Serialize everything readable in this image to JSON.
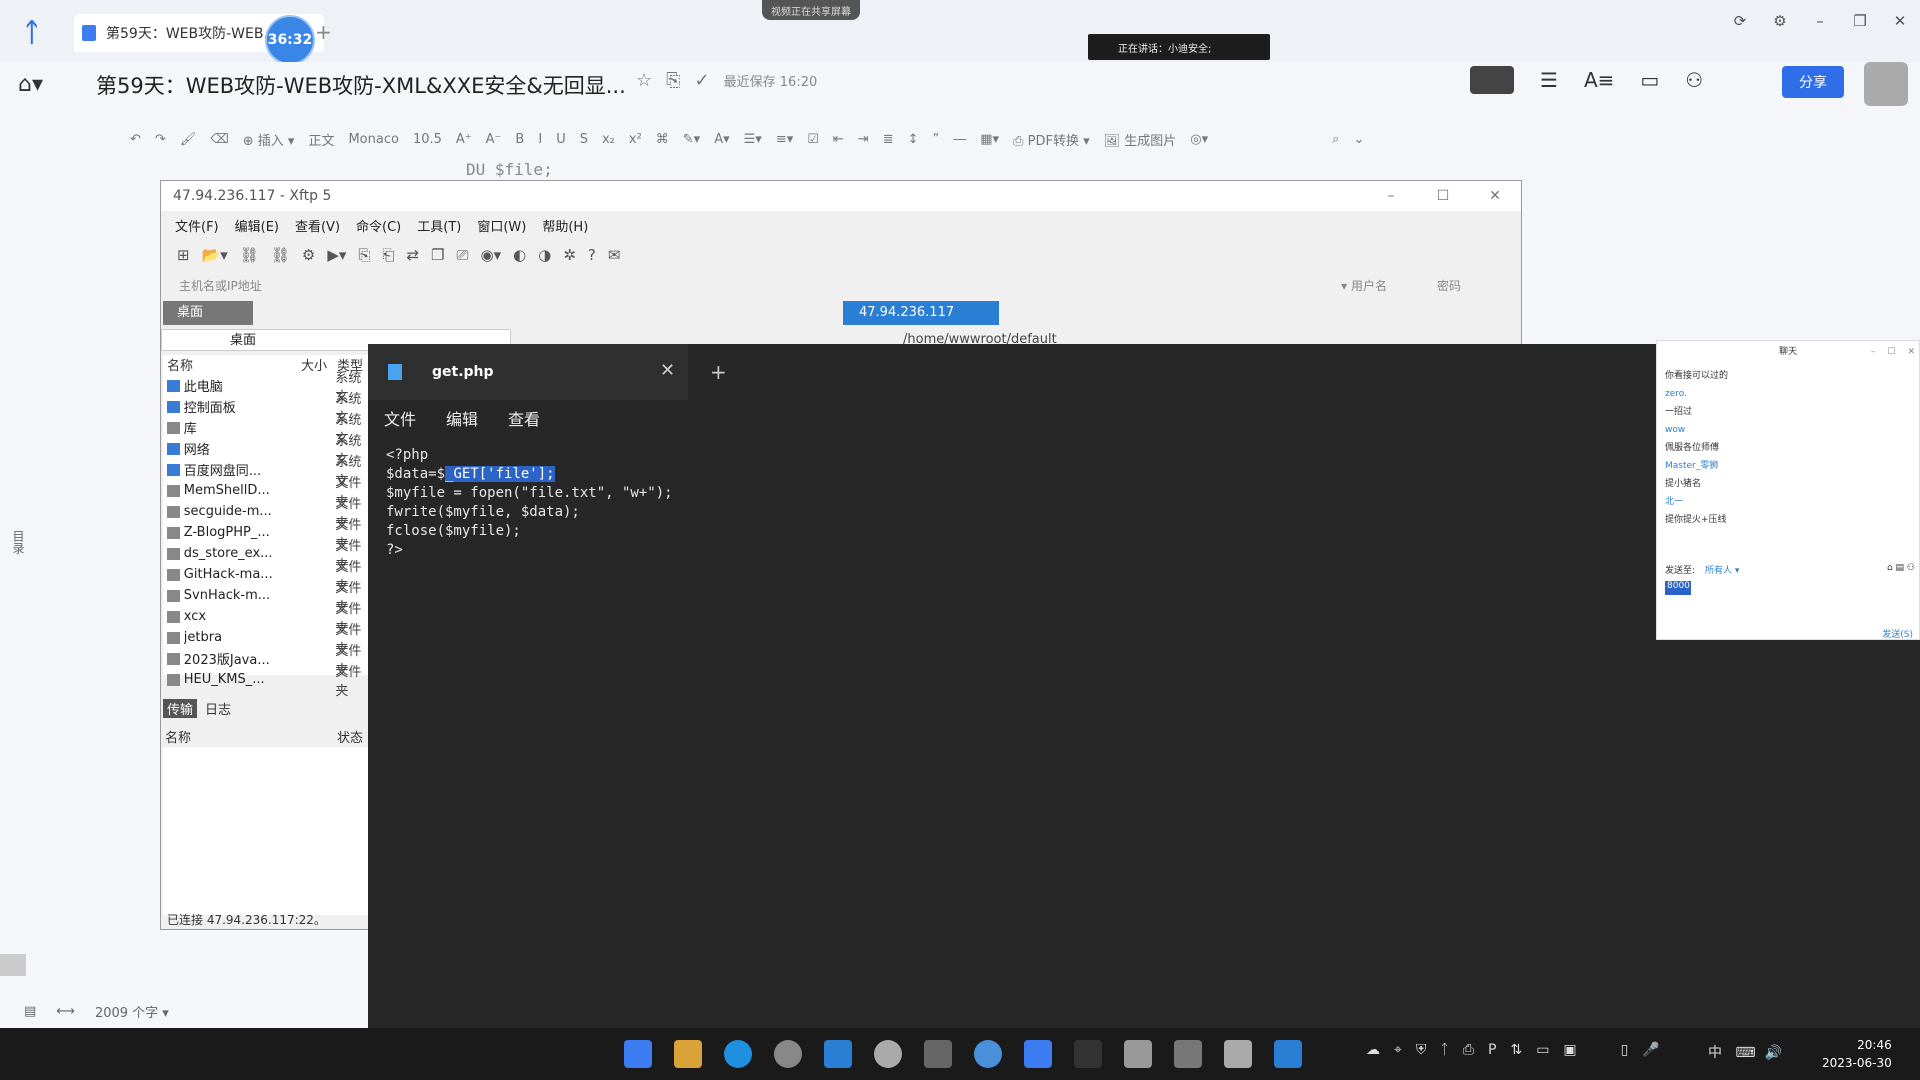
{
  "doc_app": {
    "tab_title": "第59天：WEB攻防-WEB...",
    "timer": "36:32",
    "notice": "视频正在共享屏幕",
    "rec_text": "正在讲话：小迪安全;",
    "doc_title": "第59天：WEB攻防-WEB攻防-XML&XXE安全&无回显...",
    "save_time": "最近保存 16:20",
    "share_label": "分享",
    "toolbar": {
      "insert": "插入",
      "style": "正文",
      "font": "Monaco",
      "size": "10.5",
      "pdf": "PDF转换",
      "image": "生成图片"
    },
    "code_hint": "DU        $file;",
    "outline_label": "目录",
    "word_count": "2009 个字"
  },
  "xftp": {
    "title": "47.94.236.117   - Xftp 5",
    "menu": [
      "文件(F)",
      "编辑(E)",
      "查看(V)",
      "命令(C)",
      "工具(T)",
      "窗口(W)",
      "帮助(H)"
    ],
    "address_placeholder": "主机名或IP地址",
    "user_label": "用户名",
    "password_label": "密码",
    "local_tab": "桌面",
    "remote_tab": "47.94.236.117",
    "local_path": "桌面",
    "remote_path": "/home/wwwroot/default",
    "columns": {
      "name": "名称",
      "size": "大小",
      "type": "类型"
    },
    "files": [
      {
        "name": "此电脑",
        "type": "系统文",
        "icon": "pc"
      },
      {
        "name": "控制面板",
        "type": "系统文",
        "icon": "pc"
      },
      {
        "name": "库",
        "type": "系统文",
        "icon": "folder"
      },
      {
        "name": "网络",
        "type": "系统文",
        "icon": "pc"
      },
      {
        "name": "百度网盘同...",
        "type": "系统文",
        "icon": "pc"
      },
      {
        "name": "MemShellD...",
        "type": "文件夹",
        "icon": "folder"
      },
      {
        "name": "secguide-m...",
        "type": "文件夹",
        "icon": "folder"
      },
      {
        "name": "Z-BlogPHP_...",
        "type": "文件夹",
        "icon": "folder"
      },
      {
        "name": "ds_store_ex...",
        "type": "文件夹",
        "icon": "folder"
      },
      {
        "name": "GitHack-ma...",
        "type": "文件夹",
        "icon": "folder"
      },
      {
        "name": "SvnHack-m...",
        "type": "文件夹",
        "icon": "folder"
      },
      {
        "name": "xcx",
        "type": "文件夹",
        "icon": "folder"
      },
      {
        "name": "jetbra",
        "type": "文件夹",
        "icon": "folder"
      },
      {
        "name": "2023版Java...",
        "type": "文件夹",
        "icon": "folder"
      },
      {
        "name": "HEU_KMS_...",
        "type": "文件夹",
        "icon": "folder"
      }
    ],
    "transfer_tab": "传输",
    "log_tab": "日志",
    "transfer_name_col": "名称",
    "transfer_status_col": "状态",
    "status": "已连接 47.94.236.117:22。"
  },
  "notepad": {
    "filename": "get.php",
    "menu": [
      "文件",
      "编辑",
      "查看"
    ],
    "code": {
      "l1": "<?php",
      "l2_pre": "$data=$",
      "l2_sel": "_GET['file'];",
      "l3": "$myfile = fopen(\"file.txt\", \"w+\");",
      "l4": "fwrite($myfile, $data);",
      "l5": "fclose($myfile);",
      "l6": "?>"
    }
  },
  "chat": {
    "title": "聊天",
    "lines": [
      {
        "text": "你看接可以过的",
        "blue": false
      },
      {
        "text": "zero.",
        "blue": true
      },
      {
        "text": "一招过",
        "blue": false
      },
      {
        "text": "wow",
        "blue": true
      },
      {
        "text": "佩服各位师傅",
        "blue": false
      },
      {
        "text": "Master_零狮",
        "blue": true
      },
      {
        "text": "提小猪名",
        "blue": false
      },
      {
        "text": "北一",
        "blue": true
      },
      {
        "text": "提你提火+压线",
        "blue": false
      }
    ],
    "send_to_label": "发送至:",
    "send_to_value": "所有人",
    "input_value": "8000",
    "send_button": "发送(S)"
  },
  "taskbar": {
    "lang": "中",
    "time": "20:46",
    "date": "2023-06-30"
  }
}
